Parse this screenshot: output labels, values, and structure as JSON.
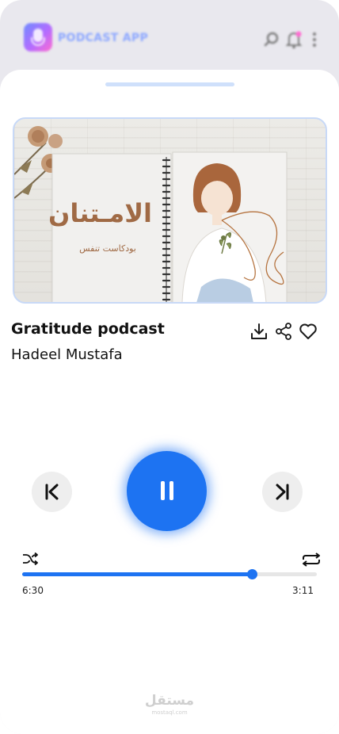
{
  "app": {
    "title": "PODCAST APP",
    "icons": [
      "search-icon",
      "bell-icon",
      "more-vertical-icon"
    ]
  },
  "cover": {
    "title": "الامـتنان",
    "subtitle": "بودكاست تنفس"
  },
  "track": {
    "title": "Gratitude podcast",
    "artist": "Hadeel Mustafa",
    "elapsed": "6:30",
    "duration": "3:11",
    "progress": 0.78,
    "state": "playing"
  },
  "actions": [
    "download-icon",
    "share-icon",
    "heart-icon"
  ],
  "controls": [
    "previous-icon",
    "pause-icon",
    "next-icon",
    "shuffle-icon",
    "repeat-icon"
  ],
  "watermark": {
    "arabic": "مستقل",
    "latin": "mostaql.com"
  },
  "colors": {
    "accent": "#1d73f2",
    "cover_text": "#a06a45",
    "skip_button": "#eeeeee"
  }
}
